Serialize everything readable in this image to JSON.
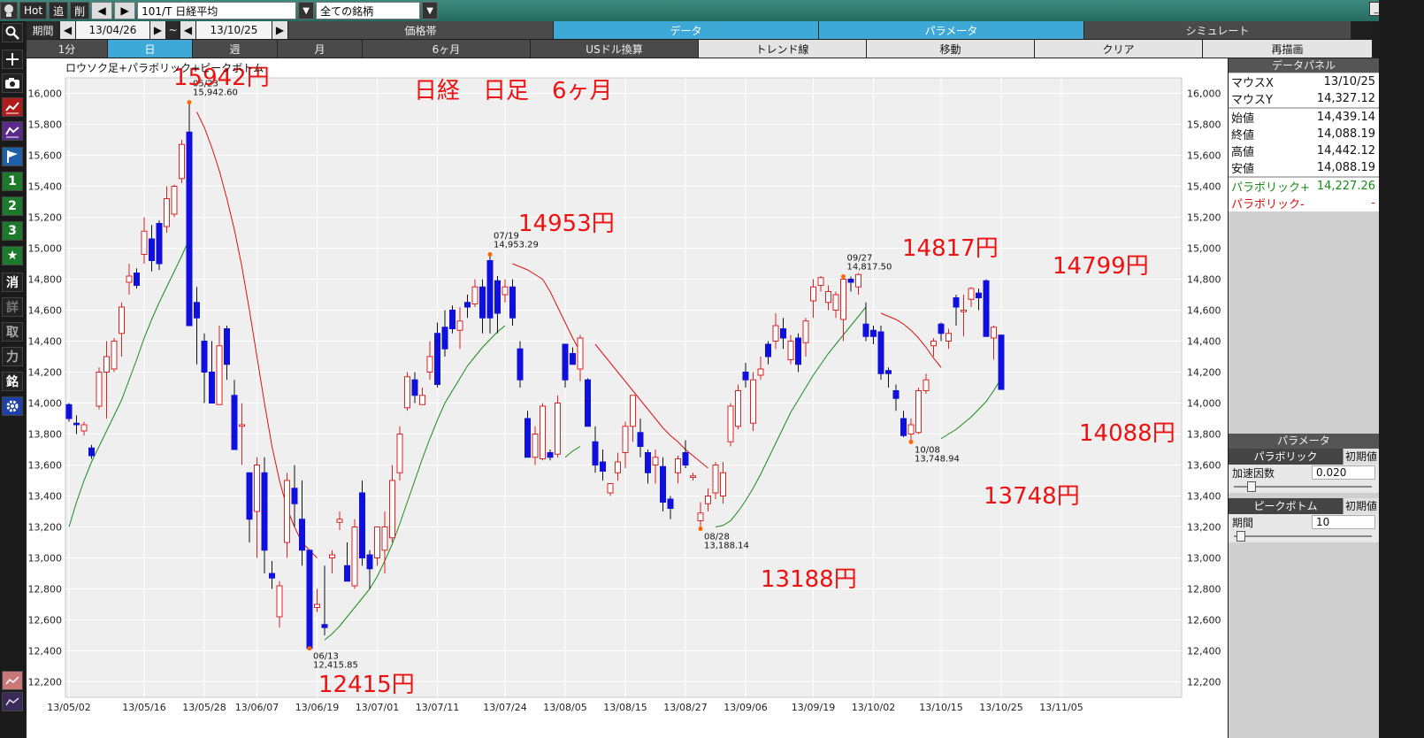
{
  "toolbar": {
    "hot": "Hot",
    "add": "追",
    "del": "削",
    "prev": "◀",
    "next": "▶",
    "symbol": "101/T 日経平均",
    "filter": "全ての銘柄"
  },
  "period_row": {
    "label": "期間",
    "start": "13/04/26",
    "tilde": "~",
    "end": "13/10/25",
    "menus": [
      "価格帯",
      "データ",
      "パラメータ",
      "シミュレート"
    ]
  },
  "timeframe_row": {
    "items": [
      "1分",
      "日",
      "週",
      "月",
      "6ヶ月",
      "USドル換算",
      "トレンド線",
      "移動",
      "クリア",
      "再描画"
    ],
    "active_index": 1
  },
  "left_tools": {
    "icons": [
      "search-icon",
      "crosshair-icon",
      "camera-icon",
      "chart-icon",
      "chart-alt-icon",
      "flag-icon"
    ],
    "labels": [
      "1",
      "2",
      "3",
      "★",
      "消",
      "詳",
      "取",
      "力",
      "銘"
    ],
    "gear": "gear-icon"
  },
  "chart": {
    "title": "ロウソク足+パラボリック+ピークボトム",
    "heading": "日経　日足　6ヶ月"
  },
  "chart_data": {
    "type": "candlestick",
    "y_axis": {
      "min": 12100,
      "max": 16100,
      "ticks": [
        12200,
        12400,
        12600,
        12800,
        13000,
        13200,
        13400,
        13600,
        13800,
        14000,
        14200,
        14400,
        14600,
        14800,
        15000,
        15200,
        15400,
        15600,
        15800,
        16000
      ]
    },
    "x_labels": [
      "13/05/02",
      "13/05/16",
      "13/05/28",
      "13/06/07",
      "13/06/19",
      "13/07/01",
      "13/07/11",
      "13/07/24",
      "13/08/05",
      "13/08/15",
      "13/08/27",
      "13/09/06",
      "13/09/19",
      "13/10/02",
      "13/10/15",
      "13/10/25",
      "13/11/05"
    ],
    "x_label_index": [
      0,
      10,
      18,
      25,
      33,
      41,
      49,
      58,
      66,
      74,
      82,
      90,
      99,
      107,
      116,
      124,
      132
    ],
    "candles": [
      [
        13990,
        13900,
        14000,
        13880
      ],
      [
        13870,
        13860,
        13920,
        13800
      ],
      [
        13820,
        13860,
        13880,
        13790
      ],
      [
        13710,
        13660,
        13730,
        13640
      ],
      [
        13980,
        14200,
        14230,
        13960
      ],
      [
        14200,
        14300,
        14400,
        13900
      ],
      [
        14220,
        14400,
        14420,
        14200
      ],
      [
        14450,
        14620,
        14650,
        14300
      ],
      [
        14780,
        14820,
        14900,
        14700
      ],
      [
        14840,
        14760,
        14870,
        14740
      ],
      [
        14960,
        15110,
        15200,
        14900
      ],
      [
        15060,
        14920,
        15150,
        14850
      ],
      [
        15160,
        14900,
        15180,
        14860
      ],
      [
        15140,
        15320,
        15400,
        15100
      ],
      [
        15220,
        15400,
        15410,
        15200
      ],
      [
        15450,
        15670,
        15700,
        15420
      ],
      [
        15750,
        14500,
        15942,
        14500
      ],
      [
        14650,
        14550,
        14750,
        14250
      ],
      [
        14400,
        14200,
        14450,
        14000
      ],
      [
        14200,
        14000,
        14400,
        14000
      ],
      [
        13990,
        14370,
        14500,
        13990
      ],
      [
        14480,
        14250,
        14500,
        14150
      ],
      [
        14050,
        13700,
        14150,
        13700
      ],
      [
        13850,
        13860,
        14000,
        13600
      ],
      [
        13550,
        13250,
        13550,
        13100
      ],
      [
        13300,
        13600,
        13650,
        13000
      ],
      [
        13550,
        13050,
        13650,
        12900
      ],
      [
        12900,
        12870,
        12980,
        12800
      ],
      [
        12620,
        12820,
        12850,
        12550
      ],
      [
        13100,
        13500,
        13550,
        13000
      ],
      [
        13450,
        13350,
        13600,
        13200
      ],
      [
        13250,
        13050,
        13500,
        12950
      ],
      [
        13050,
        12416,
        13050,
        12416
      ],
      [
        12680,
        12700,
        12800,
        12650
      ],
      [
        12570,
        12550,
        12950,
        12500
      ],
      [
        13000,
        13020,
        13050,
        12900
      ],
      [
        13230,
        13250,
        13300,
        13180
      ],
      [
        12950,
        12850,
        13100,
        12850
      ],
      [
        12820,
        13200,
        13250,
        12800
      ],
      [
        13420,
        13000,
        13500,
        12950
      ],
      [
        13020,
        12930,
        13050,
        12800
      ],
      [
        13000,
        13200,
        13200,
        12950
      ],
      [
        13050,
        13200,
        13300,
        12900
      ],
      [
        13130,
        13500,
        13600,
        13100
      ],
      [
        13550,
        13800,
        13850,
        13500
      ],
      [
        13970,
        14170,
        14200,
        13950
      ],
      [
        14150,
        14050,
        14200,
        14000
      ],
      [
        13990,
        14050,
        14100,
        14000
      ],
      [
        14200,
        14300,
        14400,
        14150
      ],
      [
        14450,
        14120,
        14520,
        14100
      ],
      [
        14490,
        14350,
        14600,
        14300
      ],
      [
        14600,
        14480,
        14630,
        14450
      ],
      [
        14470,
        14530,
        14620,
        14350
      ],
      [
        14650,
        14620,
        14700,
        14550
      ],
      [
        14640,
        14750,
        14800,
        14620
      ],
      [
        14750,
        14550,
        14800,
        14450
      ],
      [
        14920,
        14550,
        14960,
        14450
      ],
      [
        14790,
        14580,
        14820,
        14450
      ],
      [
        14700,
        14750,
        14800,
        14650
      ],
      [
        14750,
        14550,
        14800,
        14500
      ],
      [
        14350,
        14150,
        14400,
        14100
      ],
      [
        13900,
        13650,
        13950,
        13650
      ],
      [
        13650,
        13800,
        13850,
        13600
      ],
      [
        13640,
        13980,
        14000,
        13630
      ],
      [
        13680,
        13650,
        13700,
        13630
      ],
      [
        13670,
        14000,
        14050,
        13650
      ],
      [
        14380,
        14150,
        14380,
        14100
      ],
      [
        14320,
        14250,
        14360,
        14250
      ],
      [
        14220,
        14420,
        14440,
        14140
      ],
      [
        14150,
        13850,
        14160,
        13850
      ],
      [
        13750,
        13600,
        13850,
        13550
      ],
      [
        13620,
        13560,
        13700,
        13500
      ],
      [
        13420,
        13480,
        13480,
        13400
      ],
      [
        13550,
        13620,
        13680,
        13500
      ],
      [
        13680,
        13850,
        13880,
        13580
      ],
      [
        13850,
        14050,
        14050,
        13750
      ],
      [
        13810,
        13720,
        13900,
        13650
      ],
      [
        13680,
        13550,
        13700,
        13480
      ],
      [
        13600,
        13650,
        13700,
        13480
      ],
      [
        13590,
        13360,
        13650,
        13300
      ],
      [
        13380,
        13320,
        13400,
        13250
      ],
      [
        13550,
        13640,
        13660,
        13480
      ],
      [
        13680,
        13600,
        13760,
        13580
      ],
      [
        13520,
        13530,
        13550,
        13500
      ],
      [
        13240,
        13290,
        13360,
        13188
      ],
      [
        13350,
        13400,
        13450,
        13300
      ],
      [
        13420,
        13600,
        13620,
        13380
      ],
      [
        13400,
        13550,
        13620,
        13350
      ],
      [
        13750,
        13980,
        14000,
        13720
      ],
      [
        13850,
        14080,
        14120,
        13830
      ],
      [
        14200,
        14150,
        14260,
        14100
      ],
      [
        13870,
        14150,
        14200,
        13820
      ],
      [
        14180,
        14220,
        14300,
        14150
      ],
      [
        14380,
        14300,
        14400,
        14250
      ],
      [
        14400,
        14500,
        14580,
        14350
      ],
      [
        14480,
        14420,
        14550,
        14350
      ],
      [
        14280,
        14400,
        14440,
        14250
      ],
      [
        14420,
        14250,
        14450,
        14200
      ],
      [
        14390,
        14530,
        14550,
        14300
      ],
      [
        14660,
        14750,
        14800,
        14550
      ],
      [
        14760,
        14810,
        14820,
        14720
      ],
      [
        14650,
        14720,
        14760,
        14600
      ],
      [
        14600,
        14700,
        14720,
        14550
      ],
      [
        14540,
        14800,
        14817,
        14400
      ],
      [
        14800,
        14780,
        14817,
        14720
      ],
      [
        14750,
        14830,
        14840,
        14700
      ],
      [
        14510,
        14430,
        14650,
        14400
      ],
      [
        14470,
        14430,
        14500,
        14380
      ],
      [
        14460,
        14190,
        14500,
        14150
      ],
      [
        14210,
        14190,
        14230,
        14100
      ],
      [
        14080,
        14030,
        14120,
        13950
      ],
      [
        13900,
        13790,
        13950,
        13780
      ],
      [
        13800,
        13860,
        13900,
        13749
      ],
      [
        13810,
        14080,
        14100,
        13800
      ],
      [
        14080,
        14150,
        14190,
        14060
      ],
      [
        14370,
        14400,
        14420,
        14300
      ],
      [
        14510,
        14450,
        14520,
        14400
      ],
      [
        14400,
        14450,
        14480,
        14350
      ],
      [
        14680,
        14620,
        14700,
        14500
      ],
      [
        14590,
        14600,
        14700,
        14430
      ],
      [
        14670,
        14740,
        14750,
        14620
      ],
      [
        14710,
        14680,
        14740,
        14600
      ],
      [
        14790,
        14430,
        14799,
        14430
      ],
      [
        14420,
        14490,
        14500,
        14280
      ],
      [
        14439,
        14088,
        14442,
        14088
      ]
    ],
    "parabolic": [
      {
        "x": [
          0,
          1,
          2,
          3,
          4,
          5,
          6,
          7,
          8,
          9,
          10,
          11,
          12,
          13,
          14,
          15,
          16
        ],
        "y": [
          13200,
          13360,
          13500,
          13620,
          13720,
          13820,
          13920,
          14020,
          14150,
          14280,
          14420,
          14540,
          14650,
          14750,
          14850,
          14950,
          15060
        ],
        "color": "#1a8a1a"
      },
      {
        "x": [
          17,
          18,
          19,
          20,
          21,
          22,
          23,
          24,
          25,
          26,
          27,
          28,
          29,
          30,
          31,
          32,
          33
        ],
        "y": [
          15880,
          15780,
          15650,
          15500,
          15320,
          15120,
          14880,
          14600,
          14300,
          14000,
          13720,
          13500,
          13320,
          13200,
          13100,
          13050,
          13000
        ],
        "color": "#dd1111"
      },
      {
        "x": [
          34,
          35,
          36,
          37,
          38,
          39,
          40,
          41,
          42,
          43,
          44,
          45,
          46,
          47,
          48,
          49,
          50,
          51,
          52,
          53,
          54,
          55,
          56,
          57,
          58
        ],
        "y": [
          12470,
          12510,
          12560,
          12620,
          12680,
          12740,
          12800,
          12880,
          12980,
          13090,
          13220,
          13360,
          13500,
          13640,
          13770,
          13890,
          14000,
          14080,
          14160,
          14240,
          14300,
          14360,
          14410,
          14460,
          14500
        ],
        "color": "#1a8a1a"
      },
      {
        "x": [
          59,
          60,
          61,
          62,
          63,
          64,
          65,
          66,
          67,
          68
        ],
        "y": [
          14900,
          14880,
          14860,
          14830,
          14800,
          14720,
          14620,
          14520,
          14420,
          14330
        ],
        "color": "#dd1111"
      },
      {
        "x": [
          66,
          67,
          68
        ],
        "y": [
          13650,
          13690,
          13720
        ],
        "color": "#1a8a1a"
      },
      {
        "x": [
          70,
          71,
          72,
          73,
          74,
          75,
          76,
          77,
          78,
          79,
          80,
          81,
          82,
          83,
          84,
          85
        ],
        "y": [
          14380,
          14320,
          14260,
          14200,
          14140,
          14080,
          14020,
          13960,
          13900,
          13840,
          13790,
          13750,
          13700,
          13660,
          13620,
          13580
        ],
        "color": "#dd1111"
      },
      {
        "x": [
          86,
          87,
          88,
          89,
          90,
          91,
          92,
          93,
          94,
          95,
          96,
          97,
          98,
          99,
          100,
          101,
          102,
          103,
          104,
          105,
          106
        ],
        "y": [
          13200,
          13210,
          13240,
          13300,
          13370,
          13450,
          13540,
          13640,
          13740,
          13840,
          13940,
          14020,
          14100,
          14180,
          14250,
          14320,
          14380,
          14440,
          14500,
          14560,
          14620
        ],
        "color": "#1a8a1a"
      },
      {
        "x": [
          108,
          109,
          110,
          111,
          112,
          113,
          114,
          115,
          116
        ],
        "y": [
          14580,
          14560,
          14540,
          14510,
          14470,
          14420,
          14360,
          14290,
          14230
        ],
        "color": "#dd1111"
      },
      {
        "x": [
          116,
          117,
          118,
          119,
          120,
          121,
          122,
          123,
          124
        ],
        "y": [
          13770,
          13800,
          13830,
          13870,
          13910,
          13960,
          14010,
          14080,
          14160
        ],
        "color": "#1a8a1a"
      }
    ],
    "peak_bottom": [
      {
        "index": 16,
        "type": "peak",
        "date": "05/23",
        "value": "15,942.60",
        "big": "15942円"
      },
      {
        "index": 32,
        "type": "bottom",
        "date": "06/13",
        "value": "12,415.85",
        "big": "12415円"
      },
      {
        "index": 56,
        "type": "peak",
        "date": "07/19",
        "value": "14,953.29",
        "big": "14953円"
      },
      {
        "index": 84,
        "type": "bottom",
        "date": "08/28",
        "value": "13,188.14",
        "big": "13188円"
      },
      {
        "index": 103,
        "type": "peak",
        "date": "09/27",
        "value": "14,817.50",
        "big": "14817円"
      },
      {
        "index": 112,
        "type": "bottom",
        "date": "10/08",
        "value": "13,748.94",
        "big": "13748円"
      },
      {
        "index": 122,
        "type": "peak",
        "date": "",
        "value": "",
        "big": "14799円"
      },
      {
        "index": 124,
        "type": "last",
        "date": "",
        "value": "",
        "big": "14088円"
      }
    ]
  },
  "data_panel": {
    "title": "データパネル",
    "mouse_x_label": "マウスX",
    "mouse_x": "13/10/25",
    "mouse_y_label": "マウスY",
    "mouse_y": "14,327.12",
    "open_label": "始値",
    "open": "14,439.14",
    "close_label": "終値",
    "close": "14,088.19",
    "high_label": "高値",
    "high": "14,442.12",
    "low_label": "安値",
    "low": "14,088.19",
    "para_plus_label": "パラボリック+",
    "para_plus": "14,227.26",
    "para_minus_label": "パラボリック-",
    "para_minus": "-"
  },
  "params": {
    "title": "パラメータ",
    "parabolic_tab": "パラボリック",
    "reset": "初期値",
    "accel_label": "加速因数",
    "accel": "0.020",
    "peak_tab": "ピークボトム",
    "period_label": "期間",
    "period": "10",
    "accel_slider": 0.1,
    "period_slider": 0.02
  },
  "colors": {
    "up": "#dd2222",
    "down": "#1010dd",
    "accent": "#3ea8d6",
    "annotation": "#ee1111"
  }
}
